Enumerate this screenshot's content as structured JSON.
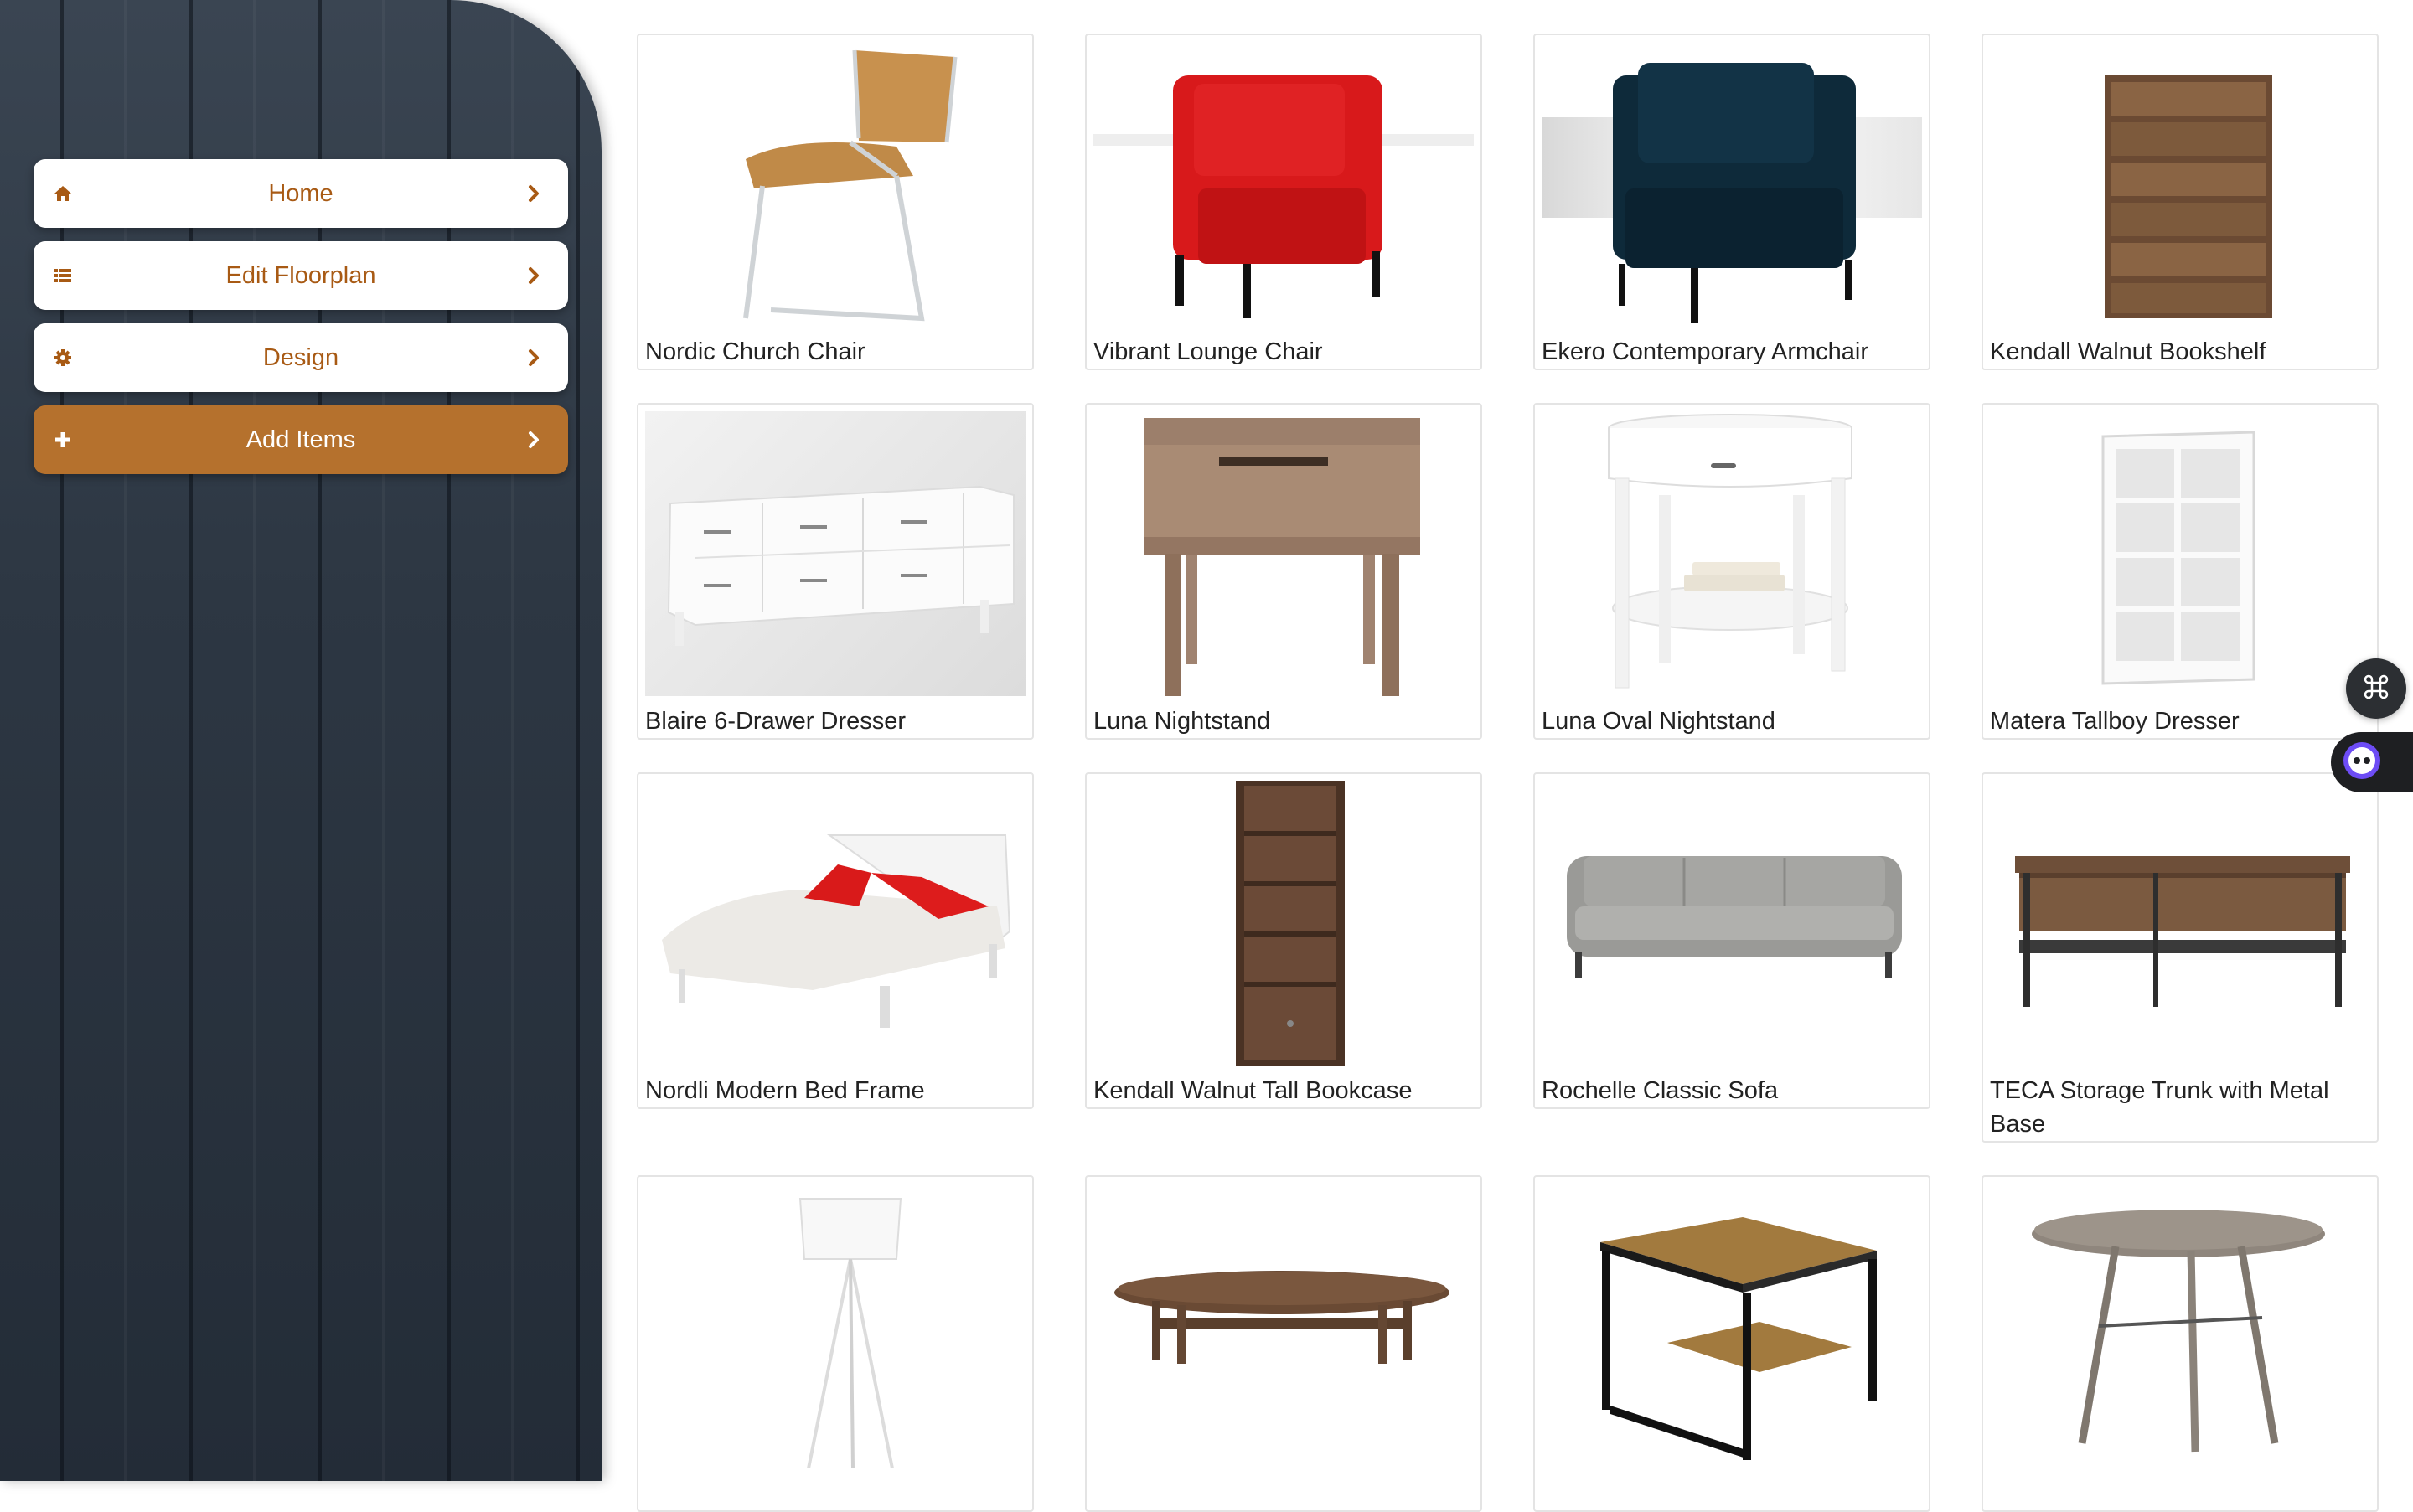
{
  "nav": {
    "items": [
      {
        "label": "Home",
        "icon": "home-icon"
      },
      {
        "label": "Edit Floorplan",
        "icon": "list-icon"
      },
      {
        "label": "Design",
        "icon": "gear-icon"
      },
      {
        "label": "Add Items",
        "icon": "plus-icon",
        "active": true
      }
    ]
  },
  "colors": {
    "accent": "#b5712d",
    "accent_text": "#a85a14",
    "sidebar": "#2d3743"
  },
  "items": [
    {
      "name": "Nordic Church Chair"
    },
    {
      "name": "Vibrant Lounge Chair"
    },
    {
      "name": "Ekero Contemporary Armchair"
    },
    {
      "name": "Kendall Walnut Bookshelf"
    },
    {
      "name": "Blaire 6-Drawer Dresser"
    },
    {
      "name": "Luna Nightstand"
    },
    {
      "name": "Luna Oval Nightstand"
    },
    {
      "name": "Matera Tallboy Dresser"
    },
    {
      "name": "Nordli Modern Bed Frame"
    },
    {
      "name": "Kendall Walnut Tall Bookcase"
    },
    {
      "name": "Rochelle Classic Sofa"
    },
    {
      "name": "TECA Storage Trunk with Metal Base"
    },
    {
      "name": ""
    },
    {
      "name": ""
    },
    {
      "name": ""
    },
    {
      "name": ""
    }
  ],
  "floating": {
    "command_icon": "command-icon",
    "assistant_icon": "assistant-icon"
  }
}
